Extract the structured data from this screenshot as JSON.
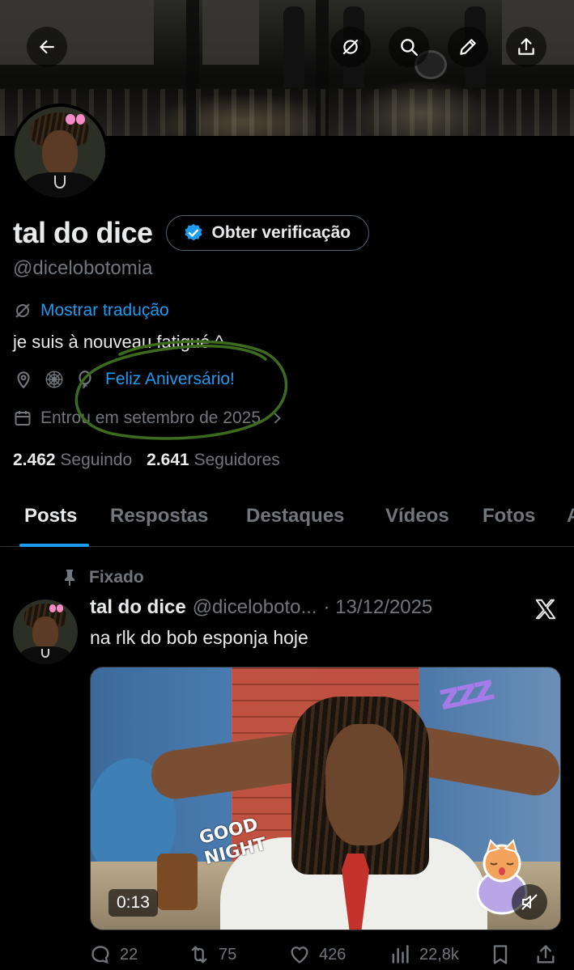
{
  "header": {
    "back_icon": "arrow-left-icon",
    "actions": [
      "translate-icon",
      "search-icon",
      "edit-icon",
      "share-icon"
    ]
  },
  "profile": {
    "display_name": "tal do dice",
    "verify_label": "Obter verificação",
    "handle": "@dicelobotomia",
    "translate_label": "Mostrar tradução",
    "bio": "je suis à nouveau fatigué ^",
    "birthday": "Feliz Aniversário!",
    "joined": "Entrou em setembro de 2025",
    "following_count": "2.462",
    "following_label": "Seguindo",
    "followers_count": "2.641",
    "followers_label": "Seguidores"
  },
  "tabs": [
    "Posts",
    "Respostas",
    "Destaques",
    "Vídeos",
    "Fotos",
    "A"
  ],
  "post": {
    "pinned_label": "Fixado",
    "author_name": "tal do dice",
    "author_handle": "@diceloboto...",
    "date": "· 13/12/2025",
    "text": "na rlk do bob esponja hoje",
    "media": {
      "sticker_line1": "GOOD",
      "sticker_line2": "NIGHT",
      "zzz": "zzz",
      "duration": "0:13"
    },
    "replies": "22",
    "reposts": "75",
    "likes": "426",
    "views": "22,8k"
  },
  "colors": {
    "accent": "#1d9bf0",
    "muted": "#71767b",
    "text": "#e7e9ea",
    "background": "#000000",
    "annotation": "#3c6b1e"
  }
}
